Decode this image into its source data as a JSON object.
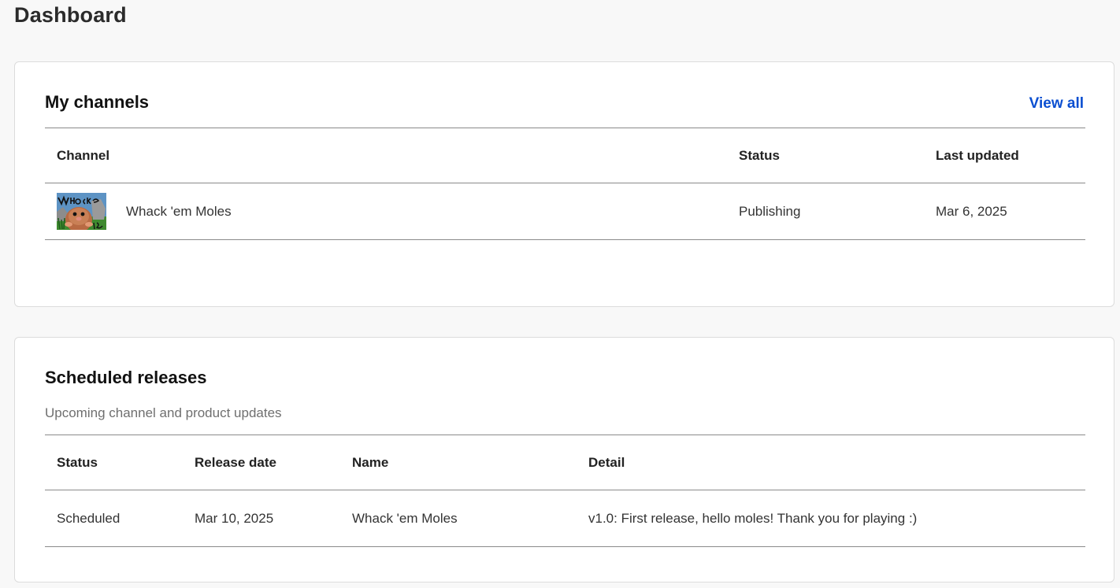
{
  "page": {
    "title": "Dashboard"
  },
  "channels_card": {
    "title": "My channels",
    "view_all_label": "View all",
    "columns": [
      "Channel",
      "Status",
      "Last updated"
    ],
    "rows": [
      {
        "thumbnail_icon": "whack-em-moles-thumbnail",
        "channel": "Whack 'em Moles",
        "status": "Publishing",
        "last_updated": "Mar 6, 2025"
      }
    ]
  },
  "releases_card": {
    "title": "Scheduled releases",
    "subtitle": "Upcoming channel and product updates",
    "columns": [
      "Status",
      "Release date",
      "Name",
      "Detail"
    ],
    "rows": [
      {
        "status": "Scheduled",
        "release_date": "Mar 10, 2025",
        "name": "Whack 'em Moles",
        "detail": "v1.0: First release, hello moles! Thank you for playing :)"
      }
    ]
  },
  "colors": {
    "link": "#0b4fd1",
    "background": "#f8f8f8",
    "card": "#ffffff",
    "divider": "#8a8a8a"
  }
}
